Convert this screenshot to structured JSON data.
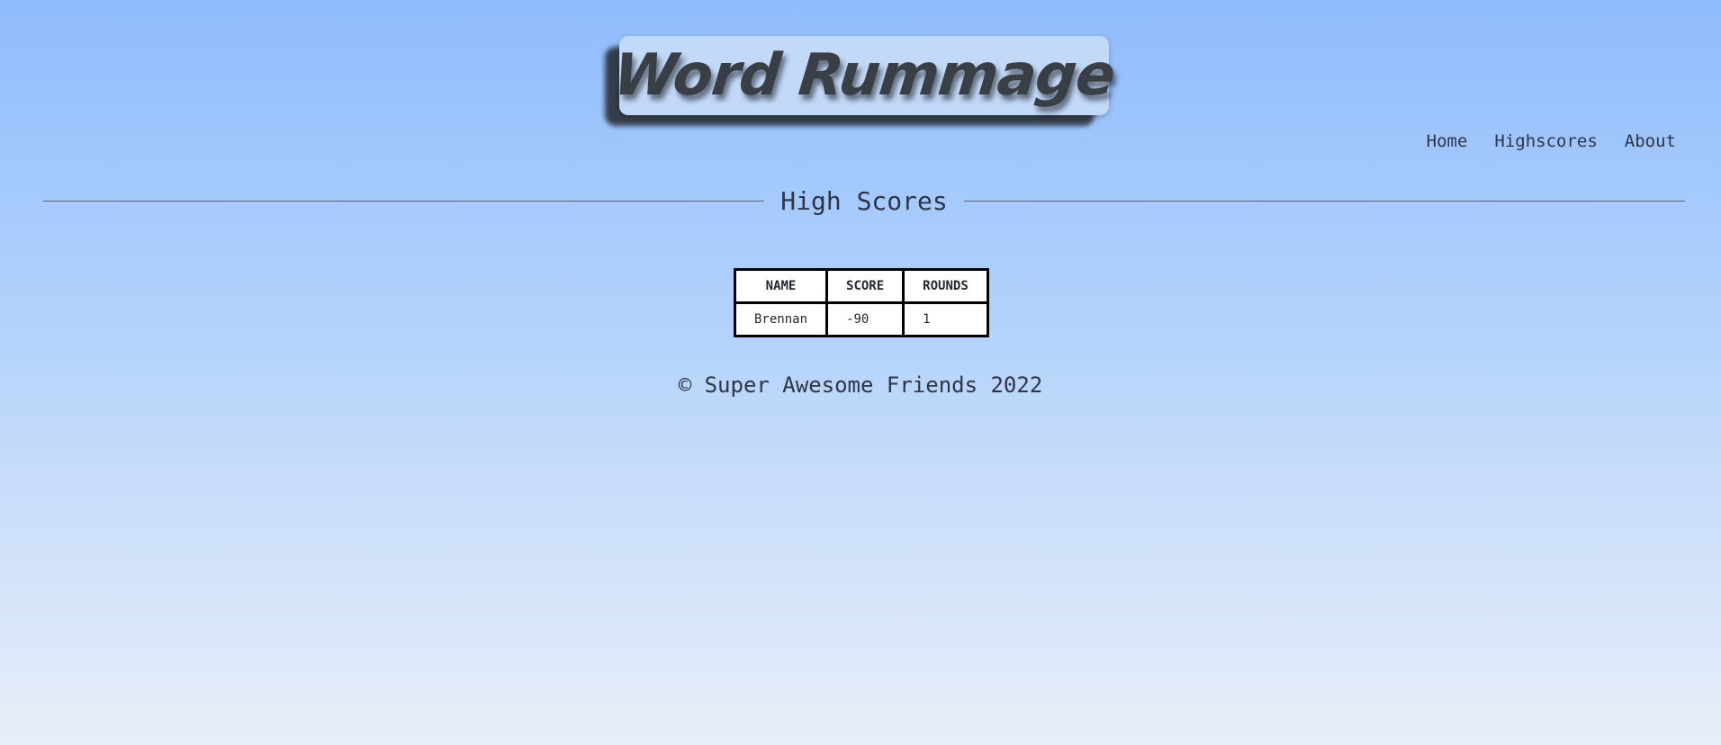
{
  "header": {
    "logo_text": "Word Rummage"
  },
  "nav": {
    "items": [
      "Home",
      "Highscores",
      "About"
    ]
  },
  "main": {
    "heading": "High Scores",
    "table": {
      "columns": [
        "NAME",
        "SCORE",
        "ROUNDS"
      ],
      "rows": [
        [
          "Brennan",
          "-90",
          "1"
        ]
      ]
    }
  },
  "footer": {
    "text": "© Super Awesome Friends 2022"
  }
}
